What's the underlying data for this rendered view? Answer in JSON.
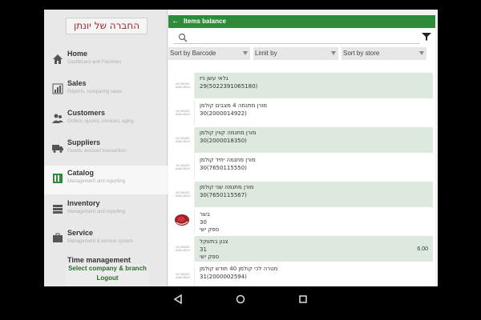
{
  "sidebar": {
    "company": "החברה של יונתן",
    "items": [
      {
        "title": "Home",
        "subtitle": "Dashboard and Favorites",
        "icon": "home-icon"
      },
      {
        "title": "Sales",
        "subtitle": "Reports, comparing sales",
        "icon": "sales-chart-icon"
      },
      {
        "title": "Customers",
        "subtitle": "Orders, quotes, invoices, aging",
        "icon": "customers-icon"
      },
      {
        "title": "Suppliers",
        "subtitle": "Goods, account transaction",
        "icon": "truck-icon"
      },
      {
        "title": "Catalog",
        "subtitle": "Management and reporting",
        "icon": "catalog-icon"
      },
      {
        "title": "Inventory",
        "subtitle": "Management and reporting",
        "icon": "inventory-icon"
      },
      {
        "title": "Service",
        "subtitle": "Management & service system",
        "icon": "service-icon"
      }
    ],
    "partial_item": "Time management",
    "select_company": "Select company & branch",
    "logout": "Logout"
  },
  "header": {
    "title": "Items balance",
    "back_icon": "back-arrow-icon"
  },
  "search": {
    "placeholder": ""
  },
  "sorts": [
    {
      "label": "Sort by Barcode"
    },
    {
      "label": "Limit by"
    },
    {
      "label": "Sort by store"
    }
  ],
  "no_image": "NO IMAGE AVAILABLE",
  "items": [
    {
      "line1": "גלאי עשן ניז",
      "line2": "29(5022391065180)",
      "line3": "",
      "qty": "",
      "image": "none"
    },
    {
      "line1": "מורן מתנמה 4 מצבים קולמן",
      "line2": "30(2000014922)",
      "line3": "",
      "qty": "",
      "image": "none"
    },
    {
      "line1": "מורן מתנמה קווין קולמן",
      "line2": "30(2000018350)",
      "line3": "",
      "qty": "",
      "image": "none"
    },
    {
      "line1": "מורן מתנמה יחיד קולמן",
      "line2": "30(7650115550)",
      "line3": "",
      "qty": "",
      "image": "none"
    },
    {
      "line1": "מורן מתנמה שני קולמן",
      "line2": "30(7650115567)",
      "line3": "",
      "qty": "",
      "image": "none"
    },
    {
      "line1": "בשר",
      "line2": "30",
      "line3": "ספק ישי",
      "qty": "",
      "image": "meat"
    },
    {
      "line1": "צנון בתשקל",
      "line2": "31",
      "line3": "ספק ישי",
      "qty": "6.00",
      "image": "none"
    },
    {
      "line1": "מטרה לכי קולמן 40 חודש קולמן",
      "line2": "31(2000002594)",
      "line3": "",
      "qty": "",
      "image": "none"
    }
  ],
  "colors": {
    "accent": "#2f8a3a",
    "row_shade": "#dde9df",
    "company_text": "#a3262a"
  }
}
